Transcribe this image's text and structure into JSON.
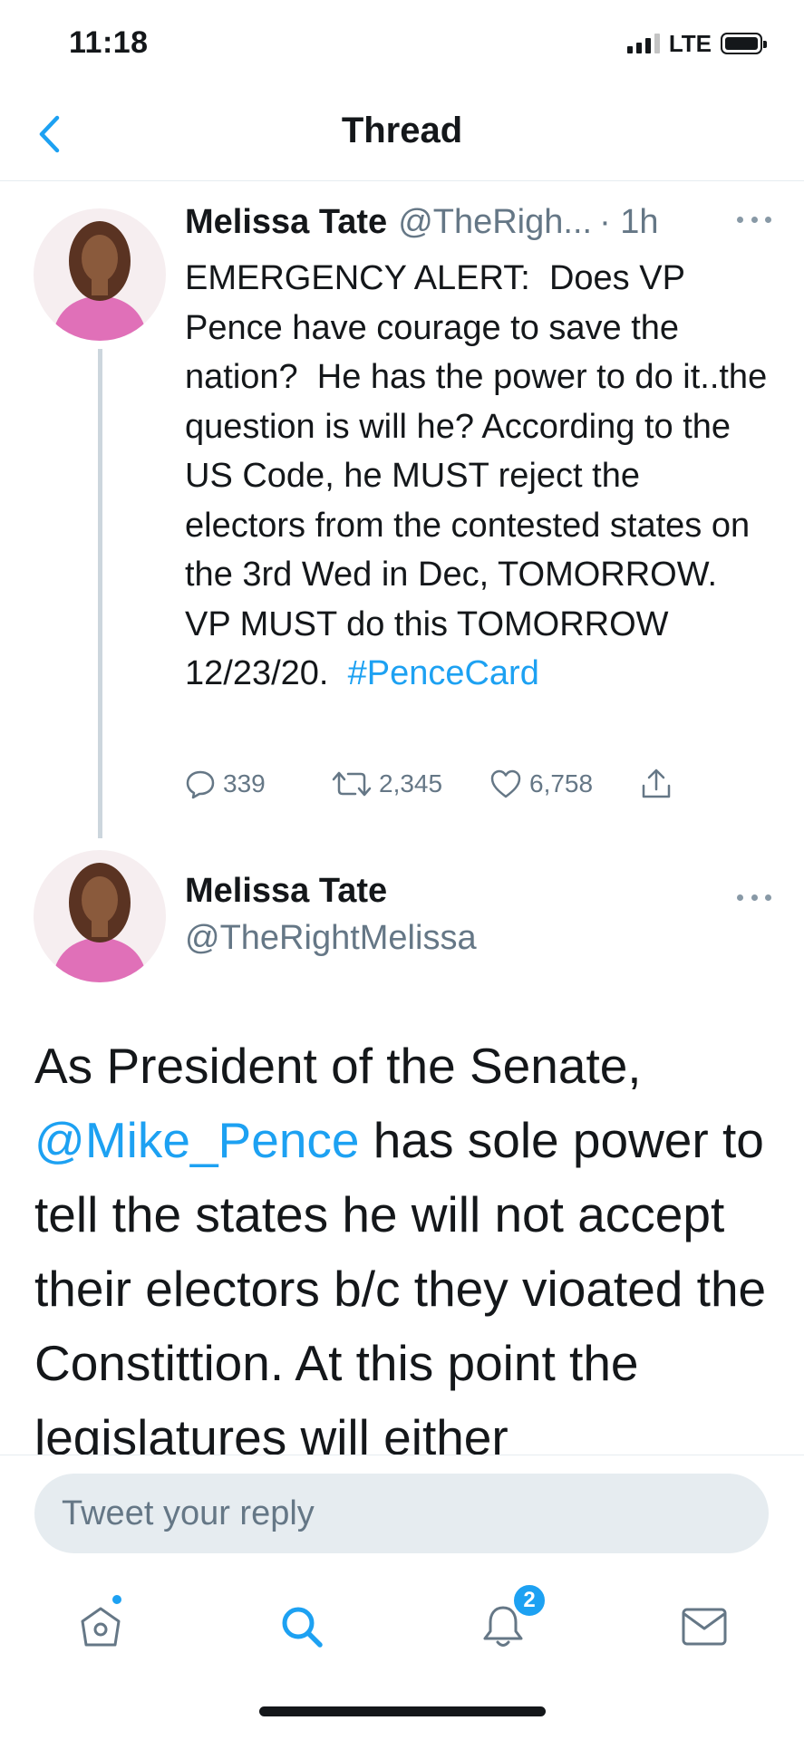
{
  "status_bar": {
    "time": "11:18",
    "network": "LTE"
  },
  "header": {
    "title": "Thread"
  },
  "tweet1": {
    "name": "Melissa Tate",
    "handle": "@TheRigh...",
    "time": "· 1h",
    "text": "EMERGENCY ALERT:  Does VP Pence have courage to save the nation?  He has the power to do it..the question is will he? According to the US Code, he MUST reject the  electors from the contested states on the 3rd Wed in Dec, TOMORROW.  VP MUST do this TOMORROW 12/23/20.  ",
    "hashtag": "#PenceCard",
    "replies": "339",
    "retweets": "2,345",
    "likes": "6,758"
  },
  "tweet2": {
    "name": "Melissa Tate",
    "handle": "@TheRightMelissa",
    "text_before": "As President of the Senate, ",
    "mention": "@Mike_Pence",
    "text_after": " has sole power to tell the states he will not accept their electors b/c they vioated the Constittion. At this point the legislatures will either"
  },
  "reply": {
    "placeholder": "Tweet your reply"
  },
  "tabbar": {
    "notifications_badge": "2"
  },
  "colors": {
    "accent": "#1da1f2",
    "text": "#14171a",
    "secondary": "#657786",
    "avatar_bg": "#e070b8"
  }
}
